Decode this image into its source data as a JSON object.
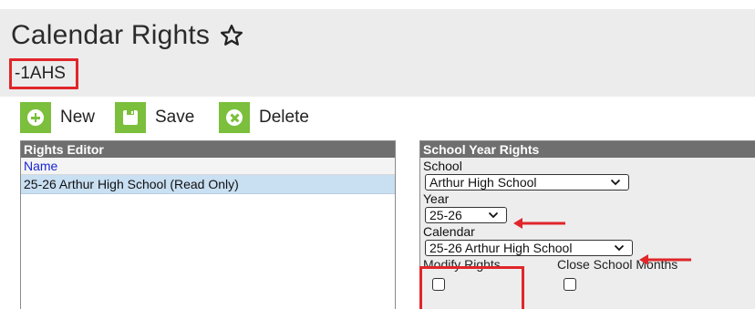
{
  "page": {
    "title": "Calendar Rights",
    "context_label": "-1AHS"
  },
  "toolbar": {
    "new_label": "New",
    "save_label": "Save",
    "delete_label": "Delete"
  },
  "rights_editor": {
    "heading": "Rights Editor",
    "column_header": "Name",
    "rows": [
      "25-26 Arthur High School (Read Only)"
    ]
  },
  "school_year_rights": {
    "heading": "School Year Rights",
    "school_label": "School",
    "school_value": "Arthur High School",
    "year_label": "Year",
    "year_value": "25-26",
    "calendar_label": "Calendar",
    "calendar_value": "25-26 Arthur High School",
    "modify_rights_label": "Modify Rights",
    "close_months_label": "Close School Months"
  },
  "colors": {
    "accent_green": "#7bbf3c",
    "highlight_red": "#e0262a",
    "selected_row": "#c9dff2",
    "panel_header": "#6f6f6f"
  }
}
